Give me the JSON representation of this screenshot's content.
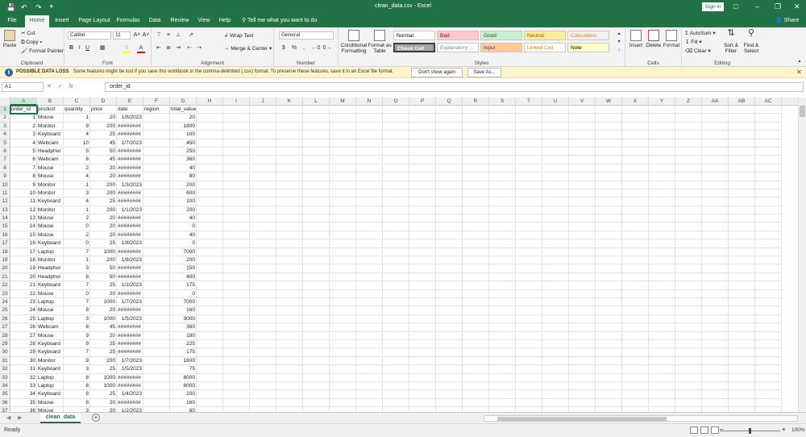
{
  "window": {
    "title": "clean_data.csv  -  Excel",
    "signin": "Sign in",
    "share": "Share",
    "tell_me": "Tell me what you want to do"
  },
  "tabs": [
    "File",
    "Home",
    "Insert",
    "Page Layout",
    "Formulas",
    "Data",
    "Review",
    "View",
    "Help"
  ],
  "active_tab": "Home",
  "ribbon": {
    "clipboard": {
      "paste": "Paste",
      "cut": "Cut",
      "copy": "Copy",
      "format_painter": "Format Painter",
      "label": "Clipboard"
    },
    "font": {
      "name": "Calibri",
      "size": "11",
      "label": "Font"
    },
    "alignment": {
      "wrap": "Wrap Text",
      "merge": "Merge & Center",
      "label": "Alignment"
    },
    "number": {
      "format": "General",
      "label": "Number"
    },
    "styles": {
      "conditional": "Conditional Formatting",
      "format_table": "Format as Table",
      "cells": [
        {
          "name": "Normal",
          "bg": "#ffffff",
          "fg": "#000000"
        },
        {
          "name": "Bad",
          "bg": "#ffc7ce",
          "fg": "#9c0006"
        },
        {
          "name": "Good",
          "bg": "#c6efce",
          "fg": "#006100"
        },
        {
          "name": "Neutral",
          "bg": "#ffeb9c",
          "fg": "#9c5700"
        },
        {
          "name": "Calculation",
          "bg": "#f2f2f2",
          "fg": "#fa7d00"
        },
        {
          "name": "Check Cell",
          "bg": "#a5a5a5",
          "fg": "#ffffff"
        },
        {
          "name": "Explanatory ...",
          "bg": "#ffffff",
          "fg": "#7f7f7f"
        },
        {
          "name": "Input",
          "bg": "#ffcc99",
          "fg": "#3f3f76"
        },
        {
          "name": "Linked Cell",
          "bg": "#ffffff",
          "fg": "#fa7d00"
        },
        {
          "name": "Note",
          "bg": "#ffffcc",
          "fg": "#000000"
        }
      ],
      "label": "Styles"
    },
    "cells": {
      "insert": "Insert",
      "delete": "Delete",
      "format": "Format",
      "label": "Cells"
    },
    "editing": {
      "autosum": "AutoSum",
      "fill": "Fill",
      "clear": "Clear",
      "sort": "Sort & Filter",
      "find": "Find & Select",
      "label": "Editing"
    }
  },
  "alert": {
    "title": "POSSIBLE DATA LOSS",
    "message": "Some features might be lost if you save this workbook in the comma-delimited (.csv) format. To preserve these features, save it in an Excel file format.",
    "dont_show": "Don't show again",
    "save_as": "Save As..."
  },
  "formula_bar": {
    "name_box": "A1",
    "value": "order_id"
  },
  "columns": [
    "A",
    "B",
    "C",
    "D",
    "E",
    "F",
    "G",
    "H",
    "I",
    "J",
    "K",
    "L",
    "M",
    "N",
    "O",
    "P",
    "Q",
    "R",
    "S",
    "T",
    "U",
    "V",
    "W",
    "X",
    "Y",
    "Z",
    "AA",
    "AB",
    "AC"
  ],
  "header_row": [
    "order_id",
    "product",
    "quantity",
    "price",
    "date",
    "region",
    "total_value"
  ],
  "rows": [
    [
      1,
      "Mouse",
      1,
      20,
      "1/8/2023",
      "",
      20
    ],
    [
      2,
      "Monitor",
      9,
      200,
      "########",
      "",
      1800
    ],
    [
      3,
      "Keyboard",
      4,
      25,
      "########",
      "",
      100
    ],
    [
      4,
      "Webcam",
      10,
      45,
      "1/7/2023",
      "",
      450
    ],
    [
      5,
      "Headphor",
      5,
      50,
      "########",
      "",
      250
    ],
    [
      6,
      "Webcam",
      8,
      45,
      "########",
      "",
      360
    ],
    [
      7,
      "Mouse",
      2,
      20,
      "########",
      "",
      40
    ],
    [
      8,
      "Mouse",
      4,
      20,
      "########",
      "",
      80
    ],
    [
      9,
      "Monitor",
      1,
      200,
      "1/3/2023",
      "",
      200
    ],
    [
      10,
      "Monitor",
      3,
      200,
      "########",
      "",
      600
    ],
    [
      11,
      "Keyboard",
      4,
      25,
      "########",
      "",
      100
    ],
    [
      12,
      "Monitor",
      1,
      200,
      "1/1/2023",
      "",
      200
    ],
    [
      13,
      "Mouse",
      2,
      20,
      "########",
      "",
      40
    ],
    [
      14,
      "Mouse",
      0,
      20,
      "########",
      "",
      0
    ],
    [
      15,
      "Mouse",
      2,
      20,
      "########",
      "",
      40
    ],
    [
      16,
      "Keyboard",
      0,
      25,
      "1/8/2023",
      "",
      0
    ],
    [
      17,
      "Laptop",
      7,
      1000,
      "########",
      "",
      7000
    ],
    [
      18,
      "Monitor",
      1,
      200,
      "1/8/2023",
      "",
      200
    ],
    [
      19,
      "Headphor",
      3,
      50,
      "########",
      "",
      150
    ],
    [
      20,
      "Headphor",
      8,
      50,
      "########",
      "",
      400
    ],
    [
      21,
      "Keyboard",
      7,
      25,
      "1/2/2023",
      "",
      175
    ],
    [
      22,
      "Mouse",
      0,
      20,
      "########",
      "",
      0
    ],
    [
      23,
      "Laptop",
      7,
      1000,
      "1/7/2023",
      "",
      7000
    ],
    [
      24,
      "Mouse",
      8,
      20,
      "########",
      "",
      160
    ],
    [
      25,
      "Laptop",
      3,
      1000,
      "1/5/2023",
      "",
      3000
    ],
    [
      26,
      "Webcam",
      8,
      45,
      "########",
      "",
      360
    ],
    [
      27,
      "Mouse",
      9,
      20,
      "########",
      "",
      180
    ],
    [
      28,
      "Keyboard",
      9,
      25,
      "########",
      "",
      225
    ],
    [
      29,
      "Keyboard",
      7,
      25,
      "########",
      "",
      175
    ],
    [
      30,
      "Monitor",
      9,
      200,
      "1/7/2023",
      "",
      1800
    ],
    [
      31,
      "Keyboard",
      3,
      25,
      "1/5/2023",
      "",
      75
    ],
    [
      32,
      "Laptop",
      8,
      1000,
      "########",
      "",
      8000
    ],
    [
      33,
      "Laptop",
      8,
      1000,
      "########",
      "",
      8000
    ],
    [
      34,
      "Keyboard",
      8,
      25,
      "1/4/2023",
      "",
      200
    ],
    [
      35,
      "Mouse",
      8,
      20,
      "########",
      "",
      160
    ],
    [
      36,
      "Mouse",
      3,
      20,
      "1/2/2023",
      "",
      60
    ]
  ],
  "sheet": {
    "name": "clean_data"
  },
  "status": {
    "ready": "Ready",
    "zoom": "100%"
  }
}
